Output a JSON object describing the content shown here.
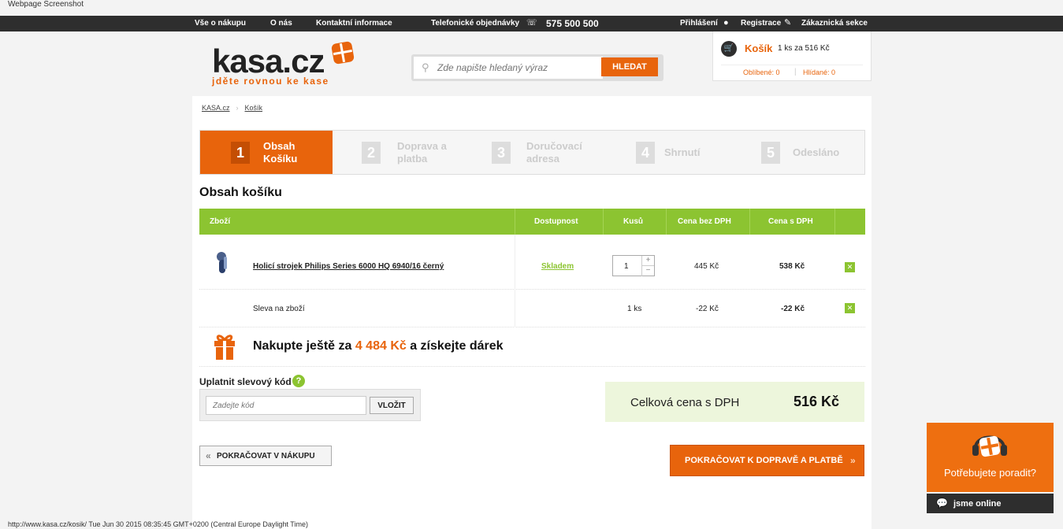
{
  "caption": "Webpage Screenshot",
  "topbar": {
    "nav": [
      "Vše o nákupu",
      "O nás",
      "Kontaktní informace"
    ],
    "phone_label": "Telefonické objednávky",
    "phone_number": "575 500 500",
    "login": "Přihlášení",
    "register": "Registrace",
    "customer": "Zákaznická sekce"
  },
  "logo": {
    "name": "kasa.cz",
    "tagline": "jděte rovnou ke kase",
    "accent": "#e8640c"
  },
  "search": {
    "placeholder": "Zde napište hledaný výraz",
    "button": "HLEDAT"
  },
  "cart": {
    "title": "Košík",
    "info": "1 ks za 516 Kč",
    "favorites": "Oblíbené: 0",
    "watched": "Hlídané: 0"
  },
  "breadcrumb": [
    "KASA.cz",
    "Košík"
  ],
  "steps": [
    {
      "num": "1",
      "line1": "Obsah",
      "line2": "Košíku",
      "active": true
    },
    {
      "num": "2",
      "line1": "Doprava a",
      "line2": "platba"
    },
    {
      "num": "3",
      "line1": "Doručovací",
      "line2": "adresa"
    },
    {
      "num": "4",
      "line1": "Shrnutí",
      "line2": ""
    },
    {
      "num": "5",
      "line1": "Odesláno",
      "line2": ""
    }
  ],
  "section_title": "Obsah košíku",
  "table": {
    "headers": [
      "Zboží",
      "Dostupnost",
      "Kusů",
      "Cena bez DPH",
      "Cena s DPH"
    ],
    "product": {
      "name": "Holicí strojek Philips Series 6000 HQ 6940/16 černý",
      "availability": "Skladem",
      "qty": "1",
      "price_net": "445 Kč",
      "price_gross": "538 Kč"
    },
    "discount": {
      "name": "Sleva na zboží",
      "qty": "1 ks",
      "price_net": "-22 Kč",
      "price_gross": "-22 Kč"
    }
  },
  "gift": {
    "before": "Nakupte ještě za ",
    "amount": "4 484 Kč",
    "after": " a získejte dárek"
  },
  "coupon": {
    "title": "Uplatnit slevový kód",
    "help": "?",
    "placeholder": "Zadejte kód",
    "button": "VLOŽIT"
  },
  "total": {
    "label": "Celková cena s DPH",
    "value": "516 Kč"
  },
  "buttons": {
    "back": "POKRAČOVAT V NÁKUPU",
    "back_arrow": "«",
    "next": "POKRAČOVAT K DOPRAVĚ A PLATBĚ",
    "next_arrow": "»"
  },
  "chat": {
    "title": "Potřebujete poradit?",
    "status": "jsme online"
  },
  "status_url": "http://www.kasa.cz/kosik/ Tue Jun 30 2015 08:35:45 GMT+0200 (Central Europe Daylight Time)"
}
